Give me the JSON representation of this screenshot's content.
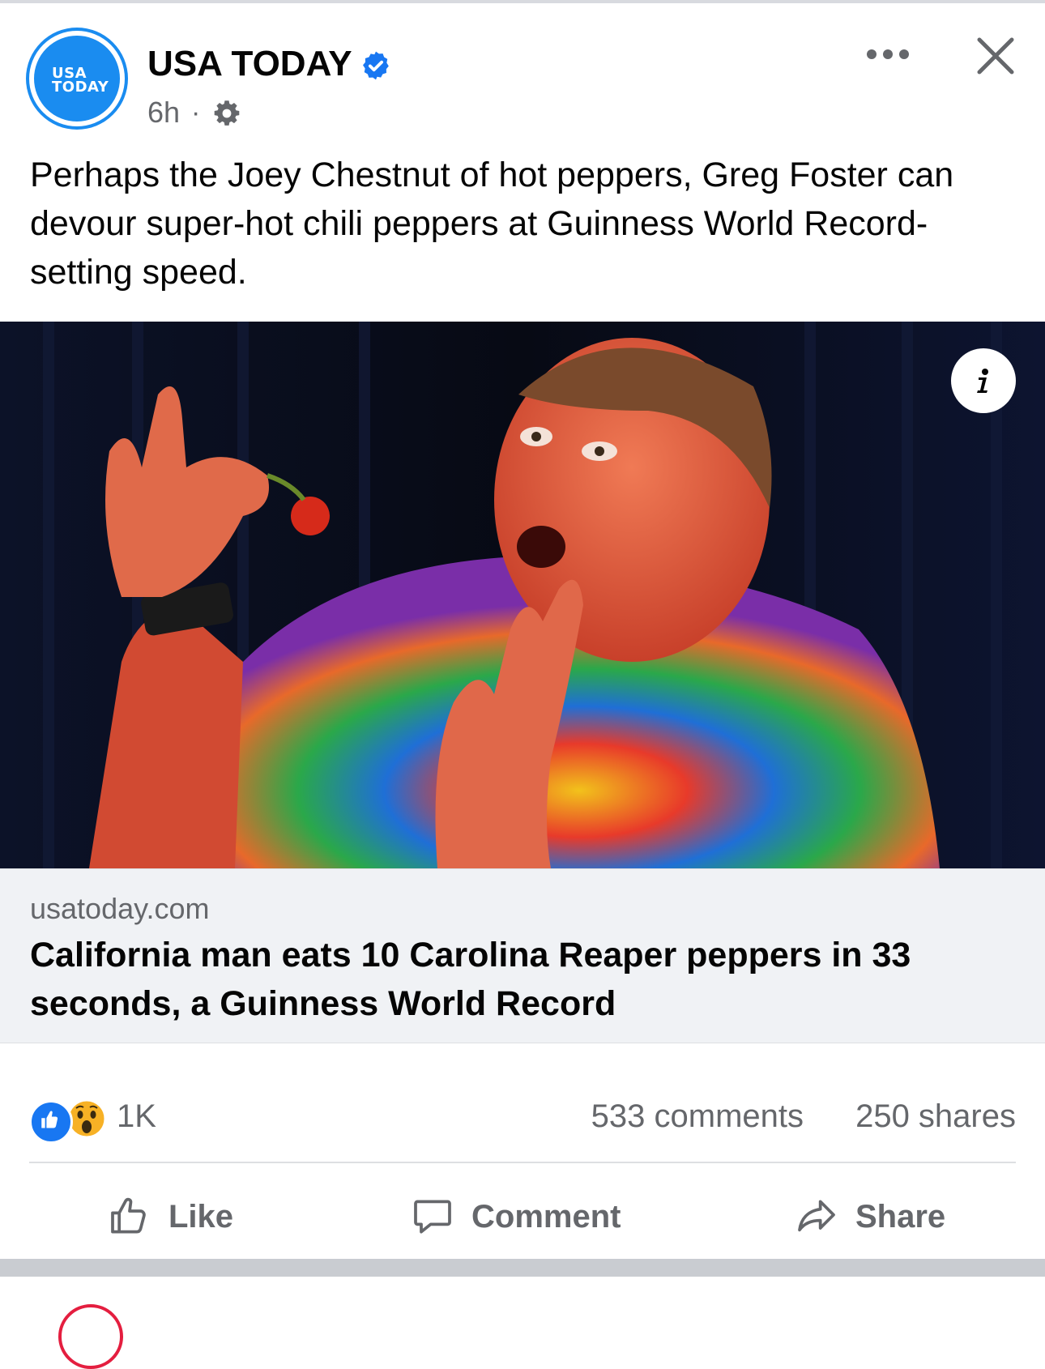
{
  "post": {
    "page_name": "USA TODAY",
    "avatar_text_line1": "USA",
    "avatar_text_line2": "TODAY",
    "time": "6h",
    "separator": "·",
    "caption": "Perhaps the Joey Chestnut of hot peppers, Greg Foster can devour super-hot chili peppers at Guinness World Record-setting speed."
  },
  "link": {
    "domain": "usatoday.com",
    "headline": "California man eats 10 Carolina Reaper peppers in 33 seconds, a Guinness World Record"
  },
  "engagement": {
    "reactions": "1K",
    "comments": "533 comments",
    "shares": "250 shares"
  },
  "actions": {
    "like": "Like",
    "comment": "Comment",
    "share": "Share"
  },
  "colors": {
    "brand_blue": "#1877f2",
    "usa_today_blue": "#1a8cf0",
    "secondary_text": "#65676b"
  }
}
